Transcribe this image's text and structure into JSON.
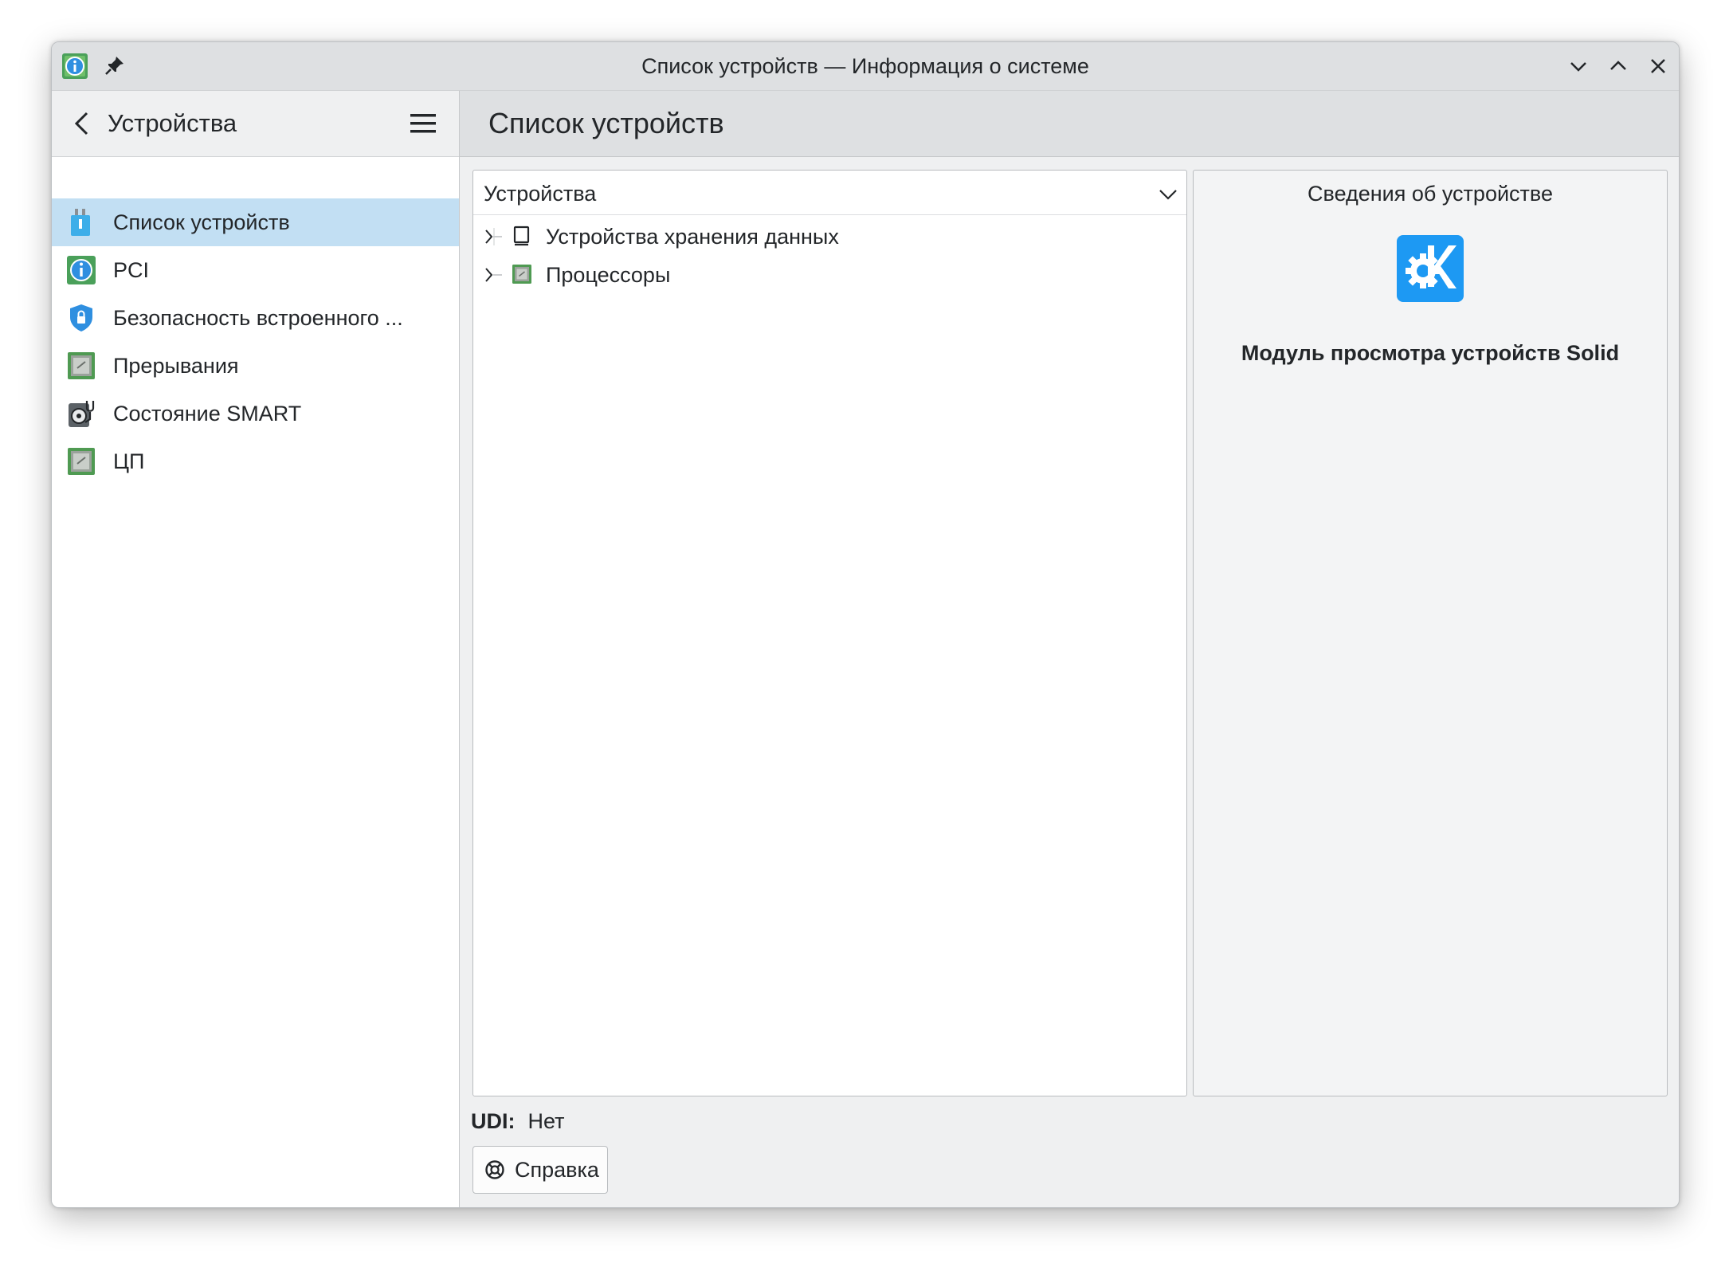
{
  "window": {
    "title": "Список устройств — Информация о системе"
  },
  "sidebar": {
    "title": "Устройства",
    "items": [
      {
        "label": "Список устройств",
        "icon": "device-list-icon",
        "active": true
      },
      {
        "label": "PCI",
        "icon": "info-icon",
        "active": false
      },
      {
        "label": "Безопасность встроенного ...",
        "icon": "shield-icon",
        "active": false
      },
      {
        "label": "Прерывания",
        "icon": "chip-icon",
        "active": false
      },
      {
        "label": "Состояние SMART",
        "icon": "stethoscope-icon",
        "active": false
      },
      {
        "label": "ЦП",
        "icon": "cpu-icon",
        "active": false
      }
    ]
  },
  "main": {
    "page_title": "Список устройств",
    "tree": {
      "filter_value": "Устройства",
      "rows": [
        {
          "label": "Устройства хранения данных",
          "icon": "storage-icon",
          "expanded": false
        },
        {
          "label": "Процессоры",
          "icon": "cpu-icon",
          "expanded": false
        }
      ]
    },
    "details": {
      "title": "Сведения об устройстве",
      "name": "Модуль просмотра устройств Solid",
      "logo": "kde-logo-icon"
    },
    "udi": {
      "label": "UDI:",
      "value": "Нет"
    },
    "help_button": "Справка"
  },
  "colors": {
    "accent": "#3daee9",
    "selection": "#c2dff3",
    "window_bg": "#eff0f1",
    "titlebar_bg": "#dee0e2"
  }
}
